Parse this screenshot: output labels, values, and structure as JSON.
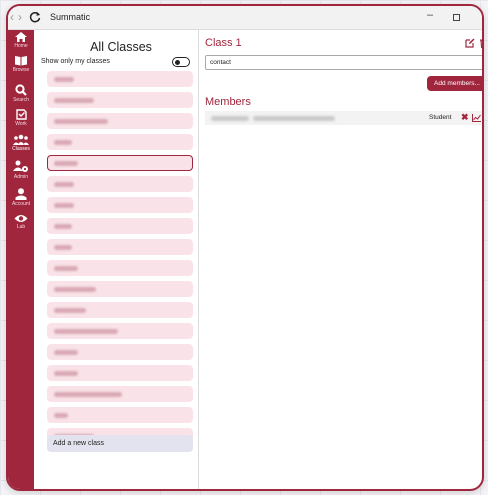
{
  "window": {
    "title": "Summatic",
    "nav_back": "‹",
    "nav_forward": "›",
    "minimize_glyph": "–"
  },
  "sidebar": {
    "items": [
      {
        "label": "Home",
        "icon": "home-icon"
      },
      {
        "label": "Browse",
        "icon": "book-icon"
      },
      {
        "label": "Search",
        "icon": "search-icon"
      },
      {
        "label": "Work",
        "icon": "work-icon"
      },
      {
        "label": "Classes",
        "icon": "group-icon",
        "active": true
      },
      {
        "label": "Admin",
        "icon": "admin-icon"
      },
      {
        "label": "Account",
        "icon": "person-icon"
      },
      {
        "label": "Lab",
        "icon": "eye-icon"
      }
    ]
  },
  "classes_panel": {
    "title": "All Classes",
    "show_only_label": "Show only my classes",
    "selected_index": 4,
    "add_new_label": "Add a new class"
  },
  "detail": {
    "class_title": "Class 1",
    "name_value": "contact",
    "add_members_label": "Add members...",
    "members_title": "Members",
    "members": [
      {
        "role": "Student"
      }
    ]
  },
  "colors": {
    "brand": "#a0263e",
    "class_item_bg": "#f9e3e8",
    "add_class_bg": "#e3e3ef"
  }
}
